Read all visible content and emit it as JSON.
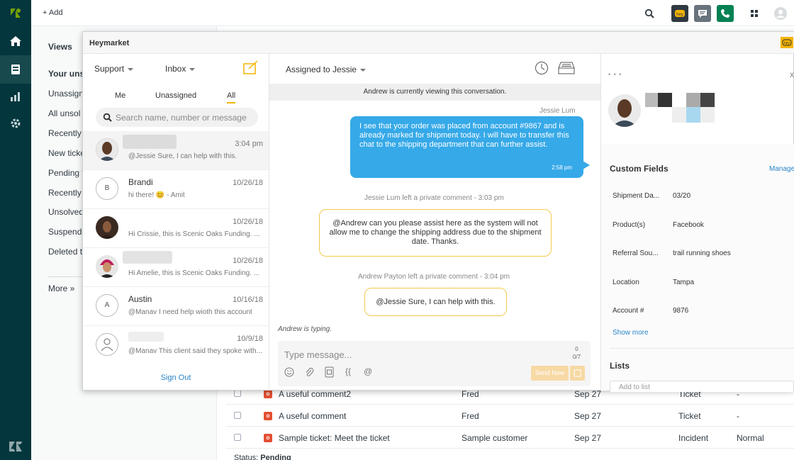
{
  "topbar": {
    "add_label": "+ Add"
  },
  "views": {
    "heading": "Views",
    "items": [
      "Your uns",
      "Unassign",
      "All unsol",
      "Recently",
      "New ticke",
      "Pending t",
      "Recently",
      "Unsolved",
      "Suspende",
      "Deleted t"
    ],
    "more": "More »"
  },
  "tickets": {
    "rows": [
      {
        "subject": "A useful comment2",
        "requester": "Fred",
        "date": "Sep 27",
        "type": "Ticket",
        "priority": "-"
      },
      {
        "subject": "A useful comment",
        "requester": "Fred",
        "date": "Sep 27",
        "type": "Ticket",
        "priority": "-"
      },
      {
        "subject": "Sample ticket: Meet the ticket",
        "requester": "Sample customer",
        "date": "Sep 27",
        "type": "Incident",
        "priority": "Normal"
      }
    ],
    "badge": "o",
    "status_label": "Status: ",
    "status_value": "Pending"
  },
  "heymarket": {
    "title": "Heymarket",
    "left": {
      "team": "Support",
      "inbox": "Inbox",
      "filters": [
        "Me",
        "Unassigned",
        "All"
      ],
      "active_filter": "All",
      "search_placeholder": "Search name, number or message",
      "conversations": [
        {
          "name": "",
          "date": "3:04 pm",
          "preview": "@Jessie Sure, I can help with this."
        },
        {
          "name": "Brandi",
          "date": "10/26/18",
          "preview": "hi there! 😊 - Amit",
          "initial": "B"
        },
        {
          "name": "",
          "date": "10/26/18",
          "preview": "Hi Crissie, this is Scenic Oaks Funding. ..."
        },
        {
          "name": "",
          "date": "10/26/18",
          "preview": "Hi Amelie, this is Scenic Oaks Funding. ..."
        },
        {
          "name": "Austin",
          "date": "10/16/18",
          "preview": "@Manav I need help wioth this account",
          "initial": "A"
        },
        {
          "name": "",
          "date": "10/9/18",
          "preview": "@Manav This client said they spoke with..."
        }
      ],
      "sign_out": "Sign Out"
    },
    "middle": {
      "assigned": "Assigned to Jessie",
      "viewing_notice": "Andrew is currently viewing this conversation.",
      "outgoing_sender": "Jessie Lum",
      "outgoing_text": "I see that your order was placed from account #9867 and is already marked for shipment today. I will have to transfer this chat to the shipping department that can further assist.",
      "outgoing_time": "2:58 pm",
      "comment1_header": "Jessie Lum left a private comment - 3:03 pm",
      "comment1_text": "@Andrew can you please assist here as the system will not allow me to change the shipping address due to the shipment date. Thanks.",
      "comment2_header": "Andrew Payton left a private comment - 3:04 pm",
      "comment2_text": "@Jessie Sure, I can help with this.",
      "typing": "Andrew is typing.",
      "composer_placeholder": "Type message...",
      "counter_top": "0",
      "counter_bottom": "0/7",
      "send_label": "Send Now",
      "tool_braces": "{{",
      "tool_at": "@"
    },
    "right": {
      "dots": "• • •",
      "close": "x",
      "custom_fields_title": "Custom Fields",
      "manage": "Manage",
      "fields": [
        {
          "label": "Shipment Da...",
          "value": "03/20"
        },
        {
          "label": "Product(s)",
          "value": "Facebook"
        },
        {
          "label": "Referral Sou...",
          "value": "trail running shoes"
        },
        {
          "label": "Location",
          "value": "Tampa"
        },
        {
          "label": "Account #",
          "value": "9876"
        }
      ],
      "show_more": "Show more",
      "lists_title": "Lists",
      "add_to_list": "Add to list"
    }
  },
  "colors": {
    "rail": "#03363d",
    "bubble": "#36a9e8",
    "note_border": "#f2c94c",
    "accent": "#f4b400",
    "link": "#2a86c9",
    "call": "#038153"
  },
  "icons": [
    "home-icon",
    "views-icon",
    "reports-icon",
    "settings-icon",
    "zendesk-logo-icon",
    "search-icon",
    "heymarket-icon",
    "chat-icon",
    "phone-icon",
    "apps-icon",
    "user-icon"
  ]
}
